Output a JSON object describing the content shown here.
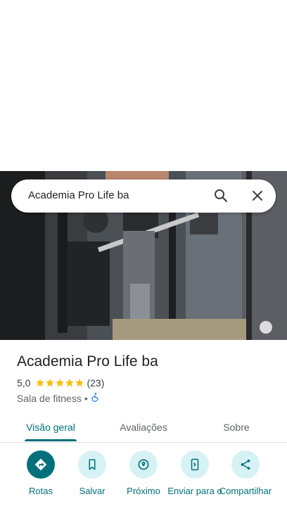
{
  "search": {
    "query": "Academia Pro Life ba"
  },
  "place": {
    "name": "Academia Pro Life ba",
    "rating": "5,0",
    "stars": 5,
    "reviews_count": "(23)",
    "category": "Sala de fitness",
    "separator": "•"
  },
  "tabs": [
    {
      "label": "Visão geral",
      "active": true
    },
    {
      "label": "Avaliações",
      "active": false
    },
    {
      "label": "Sobre",
      "active": false
    }
  ],
  "actions": [
    {
      "label": "Rotas",
      "icon": "directions-icon"
    },
    {
      "label": "Salvar",
      "icon": "bookmark-icon"
    },
    {
      "label": "Próximo",
      "icon": "nearby-icon"
    },
    {
      "label": "Enviar para o",
      "icon": "send-to-phone-icon"
    },
    {
      "label": "Compartilhar",
      "icon": "share-icon"
    }
  ],
  "colors": {
    "accent": "#00707a",
    "action_bg": "#d6f2f5",
    "star": "#fbbc04",
    "accessible": "#1a73e8"
  }
}
